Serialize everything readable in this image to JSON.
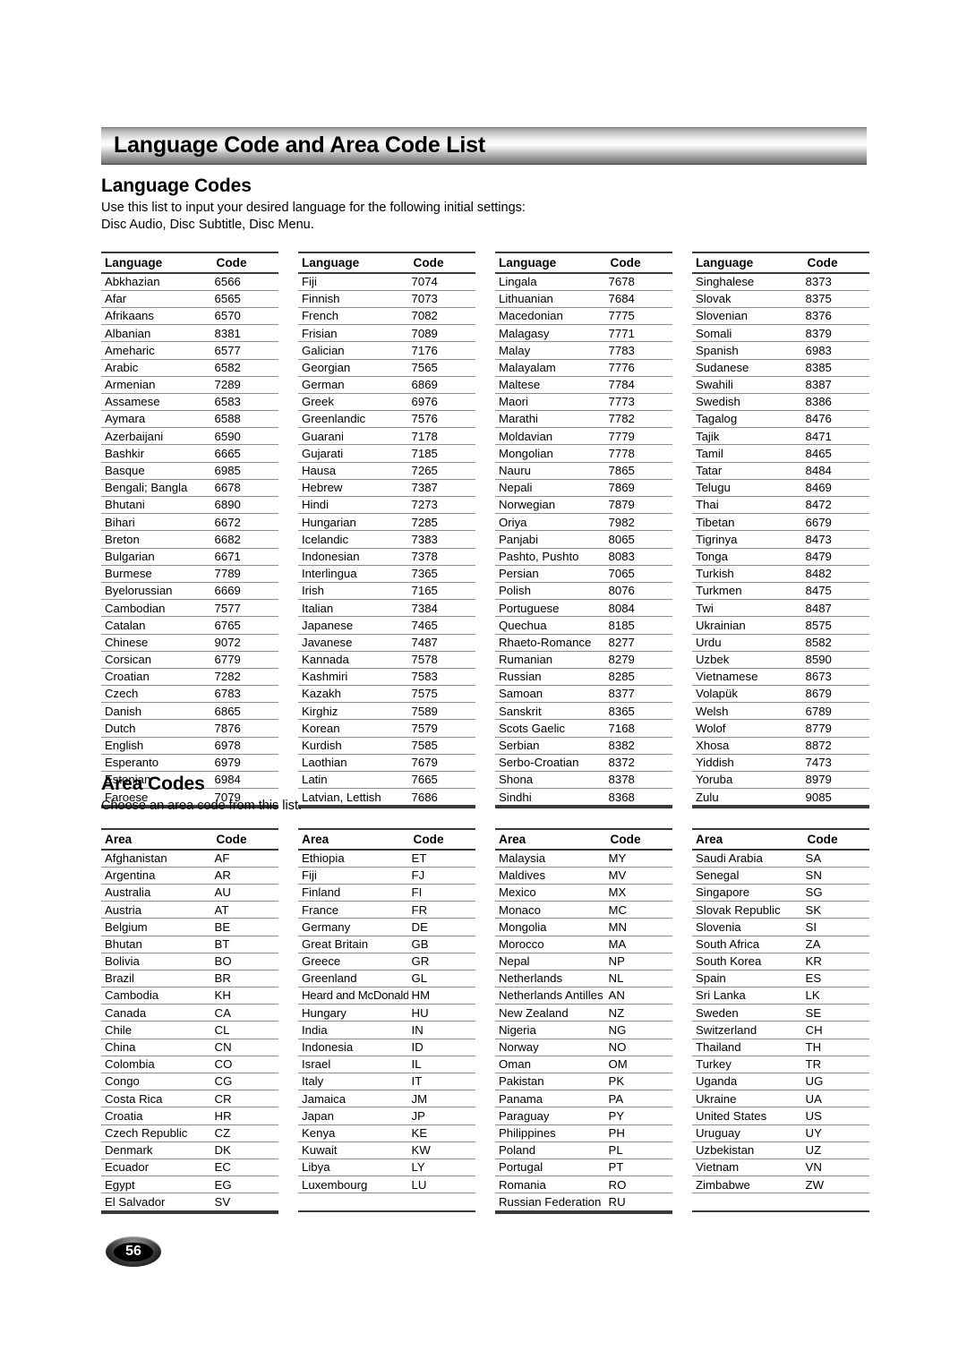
{
  "page": {
    "banner_title": "Language Code and Area Code List",
    "page_number": "56"
  },
  "language_section": {
    "title": "Language Codes",
    "intro": "Use this list to input your desired language for the following initial settings:\nDisc Audio, Disc Subtitle, Disc Menu.",
    "headers": {
      "name": "Language",
      "code": "Code"
    },
    "columns": [
      [
        [
          "Abkhazian",
          "6566"
        ],
        [
          "Afar",
          "6565"
        ],
        [
          "Afrikaans",
          "6570"
        ],
        [
          "Albanian",
          "8381"
        ],
        [
          "Ameharic",
          "6577"
        ],
        [
          "Arabic",
          "6582"
        ],
        [
          "Armenian",
          "7289"
        ],
        [
          "Assamese",
          "6583"
        ],
        [
          "Aymara",
          "6588"
        ],
        [
          "Azerbaijani",
          "6590"
        ],
        [
          "Bashkir",
          "6665"
        ],
        [
          "Basque",
          "6985"
        ],
        [
          "Bengali; Bangla",
          "6678"
        ],
        [
          "Bhutani",
          "6890"
        ],
        [
          "Bihari",
          "6672"
        ],
        [
          "Breton",
          "6682"
        ],
        [
          "Bulgarian",
          "6671"
        ],
        [
          "Burmese",
          "7789"
        ],
        [
          "Byelorussian",
          "6669"
        ],
        [
          "Cambodian",
          "7577"
        ],
        [
          "Catalan",
          "6765"
        ],
        [
          "Chinese",
          "9072"
        ],
        [
          "Corsican",
          "6779"
        ],
        [
          "Croatian",
          "7282"
        ],
        [
          "Czech",
          "6783"
        ],
        [
          "Danish",
          "6865"
        ],
        [
          "Dutch",
          "7876"
        ],
        [
          "English",
          "6978"
        ],
        [
          "Esperanto",
          "6979"
        ],
        [
          "Estonian",
          "6984"
        ],
        [
          "Faroese",
          "7079"
        ]
      ],
      [
        [
          "Fiji",
          "7074"
        ],
        [
          "Finnish",
          "7073"
        ],
        [
          "French",
          "7082"
        ],
        [
          "Frisian",
          "7089"
        ],
        [
          "Galician",
          "7176"
        ],
        [
          "Georgian",
          "7565"
        ],
        [
          "German",
          "6869"
        ],
        [
          "Greek",
          "6976"
        ],
        [
          "Greenlandic",
          "7576"
        ],
        [
          "Guarani",
          "7178"
        ],
        [
          "Gujarati",
          "7185"
        ],
        [
          "Hausa",
          "7265"
        ],
        [
          "Hebrew",
          "7387"
        ],
        [
          "Hindi",
          "7273"
        ],
        [
          "Hungarian",
          "7285"
        ],
        [
          "Icelandic",
          "7383"
        ],
        [
          "Indonesian",
          "7378"
        ],
        [
          "Interlingua",
          "7365"
        ],
        [
          "Irish",
          "7165"
        ],
        [
          "Italian",
          "7384"
        ],
        [
          "Japanese",
          "7465"
        ],
        [
          "Javanese",
          "7487"
        ],
        [
          "Kannada",
          "7578"
        ],
        [
          "Kashmiri",
          "7583"
        ],
        [
          "Kazakh",
          "7575"
        ],
        [
          "Kirghiz",
          "7589"
        ],
        [
          "Korean",
          "7579"
        ],
        [
          "Kurdish",
          "7585"
        ],
        [
          "Laothian",
          "7679"
        ],
        [
          "Latin",
          "7665"
        ],
        [
          "Latvian, Lettish",
          "7686"
        ]
      ],
      [
        [
          "Lingala",
          "7678"
        ],
        [
          "Lithuanian",
          "7684"
        ],
        [
          "Macedonian",
          "7775"
        ],
        [
          "Malagasy",
          "7771"
        ],
        [
          "Malay",
          "7783"
        ],
        [
          "Malayalam",
          "7776"
        ],
        [
          "Maltese",
          "7784"
        ],
        [
          "Maori",
          "7773"
        ],
        [
          "Marathi",
          "7782"
        ],
        [
          "Moldavian",
          "7779"
        ],
        [
          "Mongolian",
          "7778"
        ],
        [
          "Nauru",
          "7865"
        ],
        [
          "Nepali",
          "7869"
        ],
        [
          "Norwegian",
          "7879"
        ],
        [
          "Oriya",
          "7982"
        ],
        [
          "Panjabi",
          "8065"
        ],
        [
          "Pashto, Pushto",
          "8083"
        ],
        [
          "Persian",
          "7065"
        ],
        [
          "Polish",
          "8076"
        ],
        [
          "Portuguese",
          "8084"
        ],
        [
          "Quechua",
          "8185"
        ],
        [
          "Rhaeto-Romance",
          "8277"
        ],
        [
          "Rumanian",
          "8279"
        ],
        [
          "Russian",
          "8285"
        ],
        [
          "Samoan",
          "8377"
        ],
        [
          "Sanskrit",
          "8365"
        ],
        [
          "Scots Gaelic",
          "7168"
        ],
        [
          "Serbian",
          "8382"
        ],
        [
          "Serbo-Croatian",
          "8372"
        ],
        [
          "Shona",
          "8378"
        ],
        [
          "Sindhi",
          "8368"
        ]
      ],
      [
        [
          "Singhalese",
          "8373"
        ],
        [
          "Slovak",
          "8375"
        ],
        [
          "Slovenian",
          "8376"
        ],
        [
          "Somali",
          "8379"
        ],
        [
          "Spanish",
          "6983"
        ],
        [
          "Sudanese",
          "8385"
        ],
        [
          "Swahili",
          "8387"
        ],
        [
          "Swedish",
          "8386"
        ],
        [
          "Tagalog",
          "8476"
        ],
        [
          "Tajik",
          "8471"
        ],
        [
          "Tamil",
          "8465"
        ],
        [
          "Tatar",
          "8484"
        ],
        [
          "Telugu",
          "8469"
        ],
        [
          "Thai",
          "8472"
        ],
        [
          "Tibetan",
          "6679"
        ],
        [
          "Tigrinya",
          "8473"
        ],
        [
          "Tonga",
          "8479"
        ],
        [
          "Turkish",
          "8482"
        ],
        [
          "Turkmen",
          "8475"
        ],
        [
          "Twi",
          "8487"
        ],
        [
          "Ukrainian",
          "8575"
        ],
        [
          "Urdu",
          "8582"
        ],
        [
          "Uzbek",
          "8590"
        ],
        [
          "Vietnamese",
          "8673"
        ],
        [
          "Volapük",
          "8679"
        ],
        [
          "Welsh",
          "6789"
        ],
        [
          "Wolof",
          "8779"
        ],
        [
          "Xhosa",
          "8872"
        ],
        [
          "Yiddish",
          "7473"
        ],
        [
          "Yoruba",
          "8979"
        ],
        [
          "Zulu",
          "9085"
        ]
      ]
    ]
  },
  "area_section": {
    "title": "Area Codes",
    "intro": "Choose an area code from this list.",
    "headers": {
      "name": "Area",
      "code": "Code"
    },
    "columns": [
      [
        [
          "Afghanistan",
          "AF"
        ],
        [
          "Argentina",
          "AR"
        ],
        [
          "Australia",
          "AU"
        ],
        [
          "Austria",
          "AT"
        ],
        [
          "Belgium",
          "BE"
        ],
        [
          "Bhutan",
          "BT"
        ],
        [
          "Bolivia",
          "BO"
        ],
        [
          "Brazil",
          "BR"
        ],
        [
          "Cambodia",
          "KH"
        ],
        [
          "Canada",
          "CA"
        ],
        [
          "Chile",
          "CL"
        ],
        [
          "China",
          "CN"
        ],
        [
          "Colombia",
          "CO"
        ],
        [
          "Congo",
          "CG"
        ],
        [
          "Costa Rica",
          "CR"
        ],
        [
          "Croatia",
          "HR"
        ],
        [
          "Czech Republic",
          "CZ"
        ],
        [
          "Denmark",
          "DK"
        ],
        [
          "Ecuador",
          "EC"
        ],
        [
          "Egypt",
          "EG"
        ],
        [
          "El Salvador",
          "SV"
        ]
      ],
      [
        [
          "Ethiopia",
          "ET"
        ],
        [
          "Fiji",
          "FJ"
        ],
        [
          "Finland",
          "FI"
        ],
        [
          "France",
          "FR"
        ],
        [
          "Germany",
          "DE"
        ],
        [
          "Great Britain",
          "GB"
        ],
        [
          "Greece",
          "GR"
        ],
        [
          "Greenland",
          "GL"
        ],
        [
          "Heard and McDonald Islands",
          "HM"
        ],
        [
          "Hungary",
          "HU"
        ],
        [
          "India",
          "IN"
        ],
        [
          "Indonesia",
          "ID"
        ],
        [
          "Israel",
          "IL"
        ],
        [
          "Italy",
          "IT"
        ],
        [
          "Jamaica",
          "JM"
        ],
        [
          "Japan",
          "JP"
        ],
        [
          "Kenya",
          "KE"
        ],
        [
          "Kuwait",
          "KW"
        ],
        [
          "Libya",
          "LY"
        ],
        [
          "Luxembourg",
          "LU"
        ]
      ],
      [
        [
          "Malaysia",
          "MY"
        ],
        [
          "Maldives",
          "MV"
        ],
        [
          "Mexico",
          "MX"
        ],
        [
          "Monaco",
          "MC"
        ],
        [
          "Mongolia",
          "MN"
        ],
        [
          "Morocco",
          "MA"
        ],
        [
          "Nepal",
          "NP"
        ],
        [
          "Netherlands",
          "NL"
        ],
        [
          "Netherlands Antilles",
          "AN"
        ],
        [
          "New Zealand",
          "NZ"
        ],
        [
          "Nigeria",
          "NG"
        ],
        [
          "Norway",
          "NO"
        ],
        [
          "Oman",
          "OM"
        ],
        [
          "Pakistan",
          "PK"
        ],
        [
          "Panama",
          "PA"
        ],
        [
          "Paraguay",
          "PY"
        ],
        [
          "Philippines",
          "PH"
        ],
        [
          "Poland",
          "PL"
        ],
        [
          "Portugal",
          "PT"
        ],
        [
          "Romania",
          "RO"
        ],
        [
          "Russian Federation",
          "RU"
        ]
      ],
      [
        [
          "Saudi Arabia",
          "SA"
        ],
        [
          "Senegal",
          "SN"
        ],
        [
          "Singapore",
          "SG"
        ],
        [
          "Slovak Republic",
          "SK"
        ],
        [
          "Slovenia",
          "SI"
        ],
        [
          "South Africa",
          "ZA"
        ],
        [
          "South Korea",
          "KR"
        ],
        [
          "Spain",
          "ES"
        ],
        [
          "Sri Lanka",
          "LK"
        ],
        [
          "Sweden",
          "SE"
        ],
        [
          "Switzerland",
          "CH"
        ],
        [
          "Thailand",
          "TH"
        ],
        [
          "Turkey",
          "TR"
        ],
        [
          "Uganda",
          "UG"
        ],
        [
          "Ukraine",
          "UA"
        ],
        [
          "United States",
          "US"
        ],
        [
          "Uruguay",
          "UY"
        ],
        [
          "Uzbekistan",
          "UZ"
        ],
        [
          "Vietnam",
          "VN"
        ],
        [
          "Zimbabwe",
          "ZW"
        ]
      ]
    ]
  }
}
